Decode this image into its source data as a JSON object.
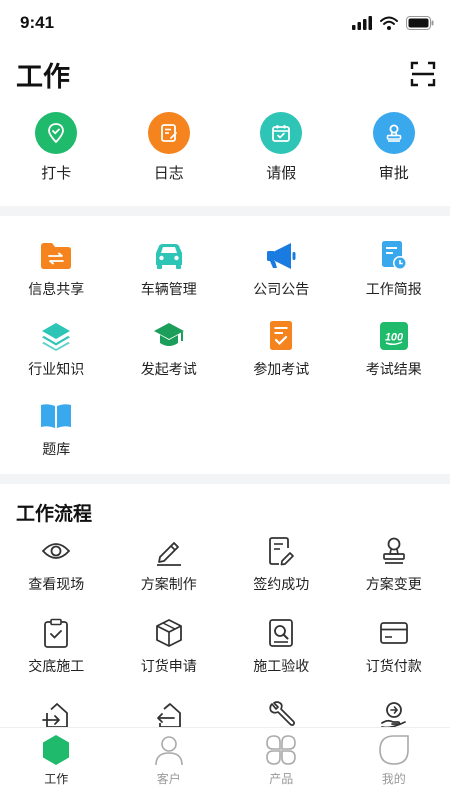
{
  "status": {
    "time": "9:41"
  },
  "header": {
    "title": "工作"
  },
  "quick_actions": [
    {
      "label": "打卡",
      "icon": "check-in-location-icon",
      "color": "#1fba6b"
    },
    {
      "label": "日志",
      "icon": "log-notebook-icon",
      "color": "#f5841f"
    },
    {
      "label": "请假",
      "icon": "calendar-leave-icon",
      "color": "#2ec4b6"
    },
    {
      "label": "审批",
      "icon": "approval-stamp-icon",
      "color": "#3aa8ec"
    }
  ],
  "apps": [
    {
      "label": "信息共享",
      "icon": "folder-share-icon"
    },
    {
      "label": "车辆管理",
      "icon": "car-icon"
    },
    {
      "label": "公司公告",
      "icon": "megaphone-icon"
    },
    {
      "label": "工作简报",
      "icon": "report-clock-icon"
    },
    {
      "label": "行业知识",
      "icon": "layers-icon"
    },
    {
      "label": "发起考试",
      "icon": "graduation-cap-icon"
    },
    {
      "label": "参加考试",
      "icon": "exam-paper-icon"
    },
    {
      "label": "考试结果",
      "icon": "score-100-icon"
    },
    {
      "label": "题库",
      "icon": "open-book-icon"
    }
  ],
  "workflow": {
    "title": "工作流程",
    "items": [
      {
        "label": "查看现场",
        "icon": "eye-icon"
      },
      {
        "label": "方案制作",
        "icon": "pen-icon"
      },
      {
        "label": "签约成功",
        "icon": "sign-document-icon"
      },
      {
        "label": "方案变更",
        "icon": "stamp-icon"
      },
      {
        "label": "交底施工",
        "icon": "clipboard-check-icon"
      },
      {
        "label": "订货申请",
        "icon": "box-cube-icon"
      },
      {
        "label": "施工验收",
        "icon": "inspect-doc-icon"
      },
      {
        "label": "订货付款",
        "icon": "card-payment-icon"
      },
      {
        "label": "",
        "icon": "arrow-into-house-icon"
      },
      {
        "label": "",
        "icon": "arrow-out-house-icon"
      },
      {
        "label": "",
        "icon": "wrench-icon"
      },
      {
        "label": "",
        "icon": "hand-coin-icon"
      }
    ]
  },
  "tabbar": [
    {
      "label": "工作",
      "icon": "work-hexagon-icon",
      "active": true
    },
    {
      "label": "客户",
      "icon": "person-icon",
      "active": false
    },
    {
      "label": "产品",
      "icon": "grid-products-icon",
      "active": false
    },
    {
      "label": "我的",
      "icon": "leaf-profile-icon",
      "active": false
    }
  ],
  "colors": {
    "accent": "#1fba6b",
    "orange": "#f5841f",
    "teal": "#2ec4b6",
    "blue": "#3aa8ec"
  }
}
